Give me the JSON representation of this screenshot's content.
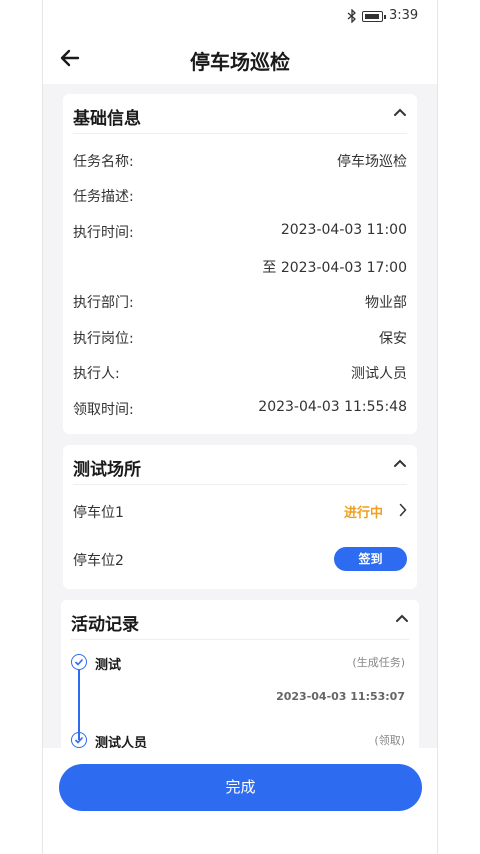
{
  "status_bar": {
    "time": "3:39"
  },
  "nav": {
    "title": "停车场巡检"
  },
  "basic_info": {
    "title": "基础信息",
    "rows": [
      {
        "label": "任务名称:",
        "value": "停车场巡检"
      },
      {
        "label": "任务描述:",
        "value": ""
      },
      {
        "label": "执行时间:",
        "value": "2023-04-03 11:00"
      },
      {
        "label": "",
        "value": "至 2023-04-03 17:00"
      },
      {
        "label": "执行部门:",
        "value": "物业部"
      },
      {
        "label": "执行岗位:",
        "value": "保安"
      },
      {
        "label": "执行人:",
        "value": "测试人员"
      },
      {
        "label": "领取时间:",
        "value": "2023-04-03 11:55:48"
      }
    ]
  },
  "test_site": {
    "title": "测试场所",
    "spots": [
      {
        "name": "停车位1",
        "status": "进行中"
      },
      {
        "name": "停车位2",
        "action": "签到"
      }
    ]
  },
  "activity": {
    "title": "活动记录",
    "items": [
      {
        "who": "测试",
        "action": "(生成任务)",
        "time": "2023-04-03 11:53:07"
      },
      {
        "who": "测试人员",
        "action": "(领取)"
      }
    ]
  },
  "footer": {
    "done_label": "完成"
  },
  "colors": {
    "accent": "#2d6cf0",
    "status_in_progress": "#f0a020",
    "background": "#f4f4f6"
  }
}
